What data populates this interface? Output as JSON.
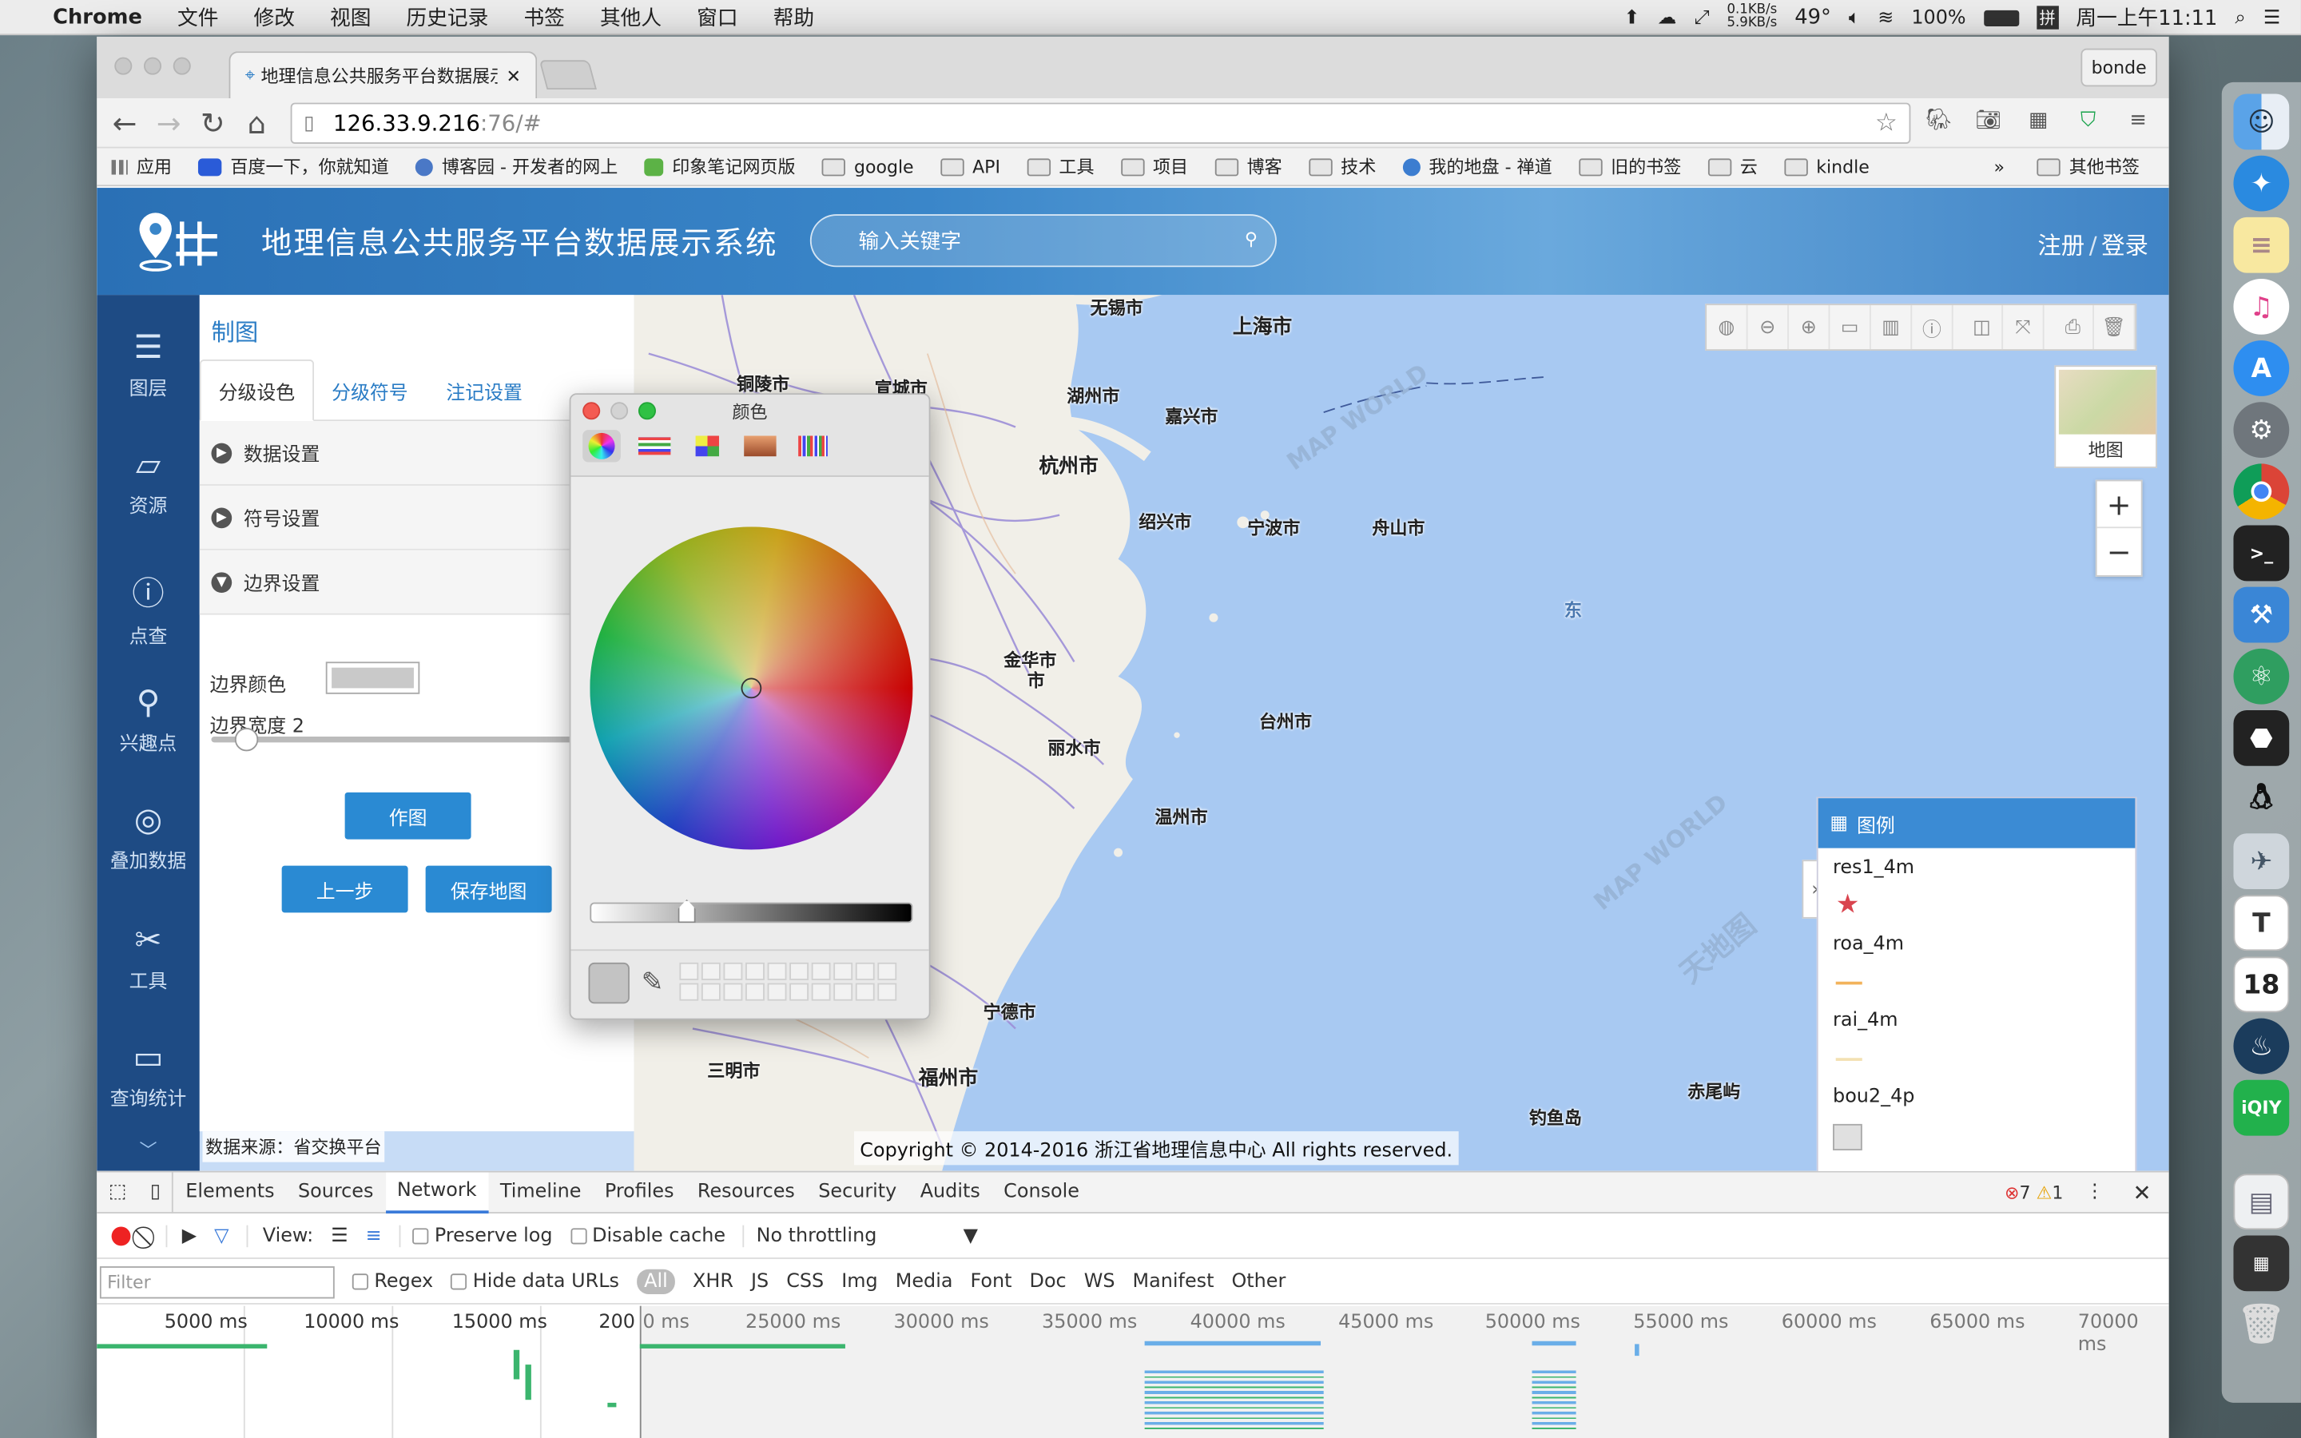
{
  "menubar": {
    "app_name": "Chrome",
    "menus": [
      "文件",
      "修改",
      "视图",
      "历史记录",
      "书签",
      "其他人",
      "窗口",
      "帮助"
    ],
    "net_up": "0.1KB/s",
    "net_down": "5.9KB/s",
    "temperature": "49°",
    "battery": "100%",
    "clock": "周一上午11:11"
  },
  "browser": {
    "tab_title": "地理信息公共服务平台数据展示",
    "profile_name": "bonde",
    "url_host": "126.33.9.216",
    "url_rest": ":76/#",
    "bookmarks": [
      "应用",
      "百度一下，你就知道",
      "博客园 - 开发者的网上",
      "印象笔记网页版",
      "google",
      "API",
      "工具",
      "项目",
      "博客",
      "技术",
      "我的地盘 - 禅道",
      "旧的书签",
      "云",
      "kindle"
    ],
    "bookmarks_more": "»",
    "other_bookmarks": "其他书签"
  },
  "header": {
    "title": "地理信息公共服务平台数据展示系统",
    "search_placeholder": "输入关键字",
    "register": "注册",
    "separator": "/",
    "login": "登录"
  },
  "sidebar": {
    "items": [
      {
        "label": "图层",
        "icon": "layers-icon"
      },
      {
        "label": "资源",
        "icon": "folder-icon"
      },
      {
        "label": "点查",
        "icon": "info-icon"
      },
      {
        "label": "兴趣点",
        "icon": "map-pin-icon"
      },
      {
        "label": "叠加数据",
        "icon": "target-icon"
      },
      {
        "label": "工具",
        "icon": "tools-icon"
      },
      {
        "label": "查询统计",
        "icon": "monitor-icon"
      }
    ],
    "more": "﹀"
  },
  "panel": {
    "title": "制图",
    "tabs": [
      "分级设色",
      "分级符号",
      "注记设置"
    ],
    "sections": [
      "数据设置",
      "符号设置",
      "边界设置"
    ],
    "border_color_label": "边界颜色",
    "border_width_label": "边界宽度 2",
    "border_color": "#c9c9c9",
    "border_width_fraction": 0.1,
    "draw_button": "作图",
    "prev_button": "上一步",
    "save_button": "保存地图"
  },
  "source_note": "数据来源：省交换平台",
  "map": {
    "cities": [
      "无锡市",
      "上海市",
      "铜陵市",
      "宣城市",
      "湖州市",
      "嘉兴市",
      "杭州市",
      "绍兴市",
      "宁波市",
      "舟山市",
      "金华市",
      "台州市",
      "丽水市",
      "温州市",
      "宁德市",
      "三明市",
      "福州市",
      "钓鱼岛",
      "赤尾屿",
      "东",
      "市"
    ],
    "basemap_label": "地图",
    "zoom_in": "+",
    "zoom_out": "−",
    "copyright": "Copyright © 2014-2016 浙江省地理信息中心 All rights reserved.",
    "watermarks": [
      "MAP WORLD",
      "天地图"
    ]
  },
  "legend": {
    "title": "图例",
    "items": [
      {
        "name": "res1_4m",
        "color": "#d9444e"
      },
      {
        "name": "roa_4m",
        "color": "#f2b35b"
      },
      {
        "name": "rai_4m",
        "color": "#f3e1b2"
      },
      {
        "name": "bou2_4p",
        "color": "#e0e0e0"
      }
    ],
    "collapse": "›"
  },
  "color_picker": {
    "title": "颜色",
    "mode_icons": [
      "color-wheel-icon",
      "sliders-icon",
      "palettes-icon",
      "image-palette-icon",
      "pencils-icon"
    ],
    "current_color": "#c3c3c3",
    "brightness_fraction": 0.3
  },
  "devtools": {
    "tabs": [
      "Elements",
      "Sources",
      "Network",
      "Timeline",
      "Profiles",
      "Resources",
      "Security",
      "Audits",
      "Console"
    ],
    "active_tab": "Network",
    "errors": "7",
    "warnings": "1",
    "toolbar": {
      "view": "View:",
      "preserve_log": "Preserve log",
      "disable_cache": "Disable cache",
      "throttling": "No throttling"
    },
    "filter": {
      "placeholder": "Filter",
      "regex": "Regex",
      "hide_data_urls": "Hide data URLs",
      "types": [
        "All",
        "XHR",
        "JS",
        "CSS",
        "Img",
        "Media",
        "Font",
        "Doc",
        "WS",
        "Manifest",
        "Other"
      ]
    },
    "overview_ticks": [
      "5000 ms",
      "10000 ms",
      "15000 ms",
      "200"
    ],
    "timeline_ticks": [
      "0 ms",
      "25000 ms",
      "30000 ms",
      "35000 ms",
      "40000 ms",
      "45000 ms",
      "50000 ms",
      "55000 ms",
      "60000 ms",
      "65000 ms",
      "70000 ms"
    ]
  }
}
